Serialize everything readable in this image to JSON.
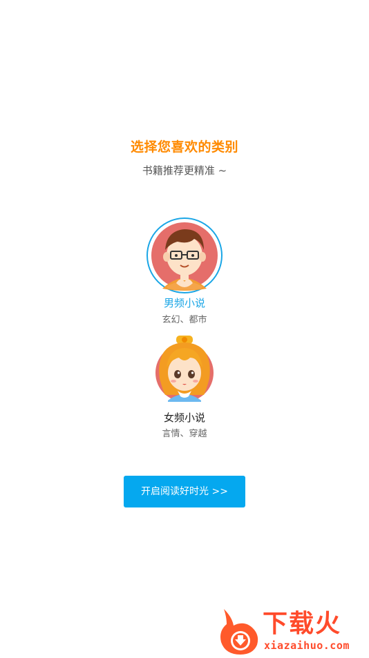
{
  "header": {
    "title": "选择您喜欢的类别",
    "subtitle": "书籍推荐更精准 ~"
  },
  "choices": [
    {
      "name": "男频小说",
      "tags": "玄幻、都市",
      "avatar_icon": "boy-avatar-icon",
      "selected": true
    },
    {
      "name": "女频小说",
      "tags": "言情、穿越",
      "avatar_icon": "girl-avatar-icon",
      "selected": false
    }
  ],
  "start_button": {
    "label": "开启阅读好时光 >>"
  },
  "watermark": {
    "logo_text": "下载火",
    "url_text": "xiazaihuo.com",
    "icon": "download-fire-icon"
  },
  "colors": {
    "title": "#ff8a00",
    "accent": "#05a8ef",
    "selected_name": "#1aa6e6",
    "watermark": "#ff4b2b"
  }
}
